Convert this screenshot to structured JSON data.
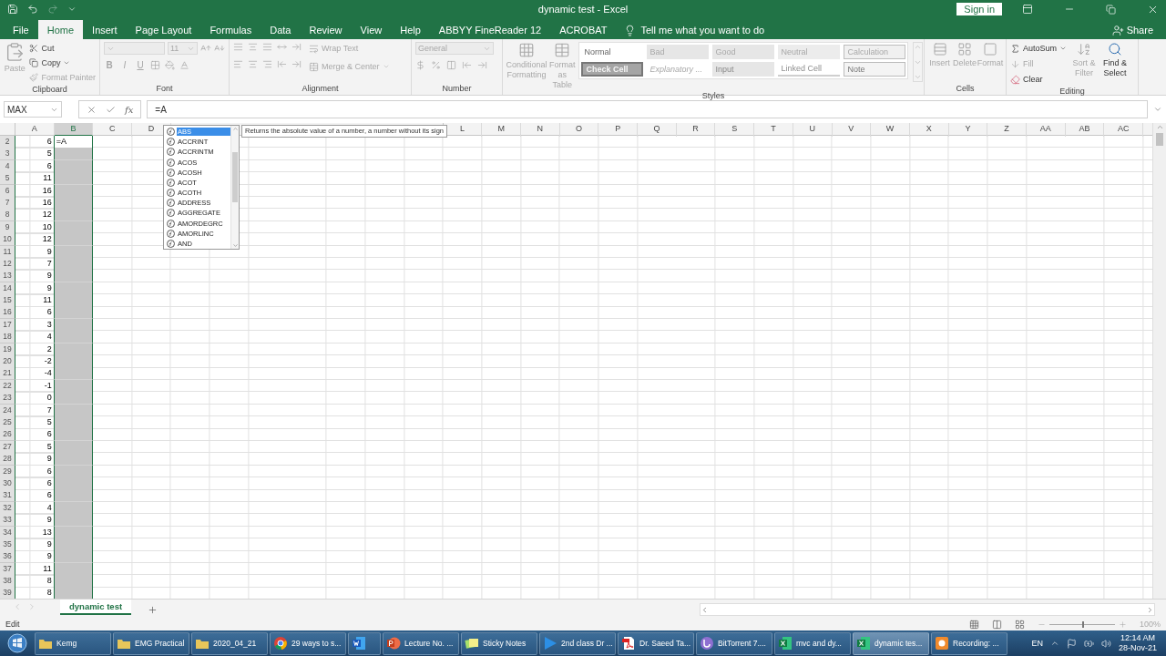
{
  "window": {
    "title": "dynamic test  -  Excel",
    "sign_in": "Sign in"
  },
  "menu_tabs": [
    {
      "label": "File",
      "selected": false
    },
    {
      "label": "Home",
      "selected": true
    },
    {
      "label": "Insert",
      "selected": false
    },
    {
      "label": "Page Layout",
      "selected": false
    },
    {
      "label": "Formulas",
      "selected": false
    },
    {
      "label": "Data",
      "selected": false
    },
    {
      "label": "Review",
      "selected": false
    },
    {
      "label": "View",
      "selected": false
    },
    {
      "label": "Help",
      "selected": false
    },
    {
      "label": "ABBYY FineReader 12",
      "selected": false
    },
    {
      "label": "ACROBAT",
      "selected": false
    }
  ],
  "tell_me": "Tell me what you want to do",
  "share": "Share",
  "ribbon": {
    "clipboard": {
      "paste": "Paste",
      "items": [
        "Cut",
        "Copy",
        "Format Painter"
      ],
      "label": "Clipboard"
    },
    "font": {
      "size": "11",
      "styles": [
        "B",
        "I",
        "U"
      ],
      "label": "Font"
    },
    "alignment": {
      "wrap": "Wrap Text",
      "merge": "Merge & Center",
      "label": "Alignment"
    },
    "number": {
      "format": "General",
      "label": "Number"
    },
    "styles": {
      "conditional": "Conditional Formatting",
      "format_table": "Format as Table",
      "label": "Styles",
      "cells": [
        {
          "label": "Normal",
          "kind": "normal"
        },
        {
          "label": "Bad",
          "kind": "bad"
        },
        {
          "label": "Good",
          "kind": "good"
        },
        {
          "label": "Neutral",
          "kind": "neutral"
        },
        {
          "label": "Calculation",
          "kind": "calculation"
        },
        {
          "label": "Check Cell",
          "kind": "check"
        },
        {
          "label": "Explanatory ...",
          "kind": "explanatory"
        },
        {
          "label": "Input",
          "kind": "input"
        },
        {
          "label": "Linked Cell",
          "kind": "linked"
        },
        {
          "label": "Note",
          "kind": "note"
        }
      ]
    },
    "cells": {
      "buttons": [
        "Insert",
        "Delete",
        "Format"
      ],
      "label": "Cells"
    },
    "editing": {
      "autosum": "AutoSum",
      "fill": "Fill",
      "clear": "Clear",
      "sort": "Sort & Filter",
      "find": "Find & Select",
      "label": "Editing"
    }
  },
  "formula_bar": {
    "name_box": "MAX",
    "fx": "fx",
    "value": "=A"
  },
  "column_headers_left": [
    "A",
    "B",
    "C",
    "D"
  ],
  "column_headers_right": [
    "L",
    "M",
    "N",
    "O",
    "P",
    "Q",
    "R",
    "S",
    "T",
    "U",
    "V",
    "W",
    "X",
    "Y",
    "Z",
    "AA",
    "AB",
    "AC"
  ],
  "rows": [
    {
      "number": "2",
      "a": "6",
      "b": "=A",
      "active": true
    },
    {
      "number": "3",
      "a": "5",
      "active": false
    },
    {
      "number": "4",
      "a": "6",
      "active": false
    },
    {
      "number": "5",
      "a": "11",
      "active": false
    },
    {
      "number": "6",
      "a": "16",
      "active": false
    },
    {
      "number": "7",
      "a": "16",
      "active": false
    },
    {
      "number": "8",
      "a": "12",
      "active": false
    },
    {
      "number": "9",
      "a": "10",
      "active": false
    },
    {
      "number": "10",
      "a": "12",
      "active": false
    },
    {
      "number": "11",
      "a": "9",
      "active": false
    },
    {
      "number": "12",
      "a": "7",
      "active": false
    },
    {
      "number": "13",
      "a": "9",
      "active": false
    },
    {
      "number": "14",
      "a": "9",
      "active": false
    },
    {
      "number": "15",
      "a": "11",
      "active": false
    },
    {
      "number": "16",
      "a": "6",
      "active": false
    },
    {
      "number": "17",
      "a": "3",
      "active": false
    },
    {
      "number": "18",
      "a": "4",
      "active": false
    },
    {
      "number": "19",
      "a": "2",
      "active": false
    },
    {
      "number": "20",
      "a": "-2",
      "active": false
    },
    {
      "number": "21",
      "a": "-4",
      "active": false
    },
    {
      "number": "22",
      "a": "-1",
      "active": false
    },
    {
      "number": "23",
      "a": "0",
      "active": false
    },
    {
      "number": "24",
      "a": "7",
      "active": false
    },
    {
      "number": "25",
      "a": "5",
      "active": false
    },
    {
      "number": "26",
      "a": "6",
      "active": false
    },
    {
      "number": "27",
      "a": "5",
      "active": false
    },
    {
      "number": "28",
      "a": "9",
      "active": false
    },
    {
      "number": "29",
      "a": "6",
      "active": false
    },
    {
      "number": "30",
      "a": "6",
      "active": false
    },
    {
      "number": "31",
      "a": "6",
      "active": false
    },
    {
      "number": "32",
      "a": "4",
      "active": false
    },
    {
      "number": "33",
      "a": "9",
      "active": false
    },
    {
      "number": "34",
      "a": "13",
      "active": false
    },
    {
      "number": "35",
      "a": "9",
      "active": false
    },
    {
      "number": "36",
      "a": "9",
      "active": false
    },
    {
      "number": "37",
      "a": "11",
      "active": false
    },
    {
      "number": "38",
      "a": "8",
      "active": false
    },
    {
      "number": "39",
      "a": "8",
      "active": false
    }
  ],
  "autocomplete": {
    "items": [
      {
        "label": "ABS",
        "selected": true
      },
      {
        "label": "ACCRINT",
        "selected": false
      },
      {
        "label": "ACCRINTM",
        "selected": false
      },
      {
        "label": "ACOS",
        "selected": false
      },
      {
        "label": "ACOSH",
        "selected": false
      },
      {
        "label": "ACOT",
        "selected": false
      },
      {
        "label": "ACOTH",
        "selected": false
      },
      {
        "label": "ADDRESS",
        "selected": false
      },
      {
        "label": "AGGREGATE",
        "selected": false
      },
      {
        "label": "AMORDEGRC",
        "selected": false
      },
      {
        "label": "AMORLINC",
        "selected": false
      },
      {
        "label": "AND",
        "selected": false
      }
    ],
    "tooltip": "Returns the absolute value of a number, a number without its sign"
  },
  "sheet_tabs": [
    {
      "label": "dynamic test",
      "selected": true
    }
  ],
  "status_bar": {
    "mode": "Edit",
    "zoom": "100%",
    "zoom_level": {
      "level": 0.5
    }
  },
  "taskbar": {
    "items": [
      {
        "kind": "folder",
        "label": "Kemg",
        "selected": false
      },
      {
        "kind": "folder",
        "label": "EMG Practical",
        "selected": false
      },
      {
        "kind": "folder",
        "label": "2020_04_21",
        "selected": false
      },
      {
        "kind": "chrome",
        "label": "29 ways to s...",
        "selected": false
      },
      {
        "kind": "word",
        "selected": false
      },
      {
        "kind": "powerpoint",
        "label": "Lecture No. ...",
        "selected": false
      },
      {
        "kind": "sticky",
        "label": "Sticky Notes",
        "selected": false
      },
      {
        "kind": "play",
        "label": "2nd class Dr ...",
        "selected": false
      },
      {
        "kind": "pdf",
        "label": "Dr. Saeed Ta...",
        "selected": false
      },
      {
        "kind": "torrent",
        "label": "BitTorrent 7....",
        "selected": false
      },
      {
        "kind": "excel",
        "label": "mvc and dy...",
        "selected": false
      },
      {
        "kind": "excel",
        "label": "dynamic tes...",
        "selected": true
      },
      {
        "kind": "recorder",
        "label": "Recording: ...",
        "selected": false
      }
    ],
    "language": "EN",
    "time": "12:14 AM",
    "date": "28-Nov-21"
  }
}
